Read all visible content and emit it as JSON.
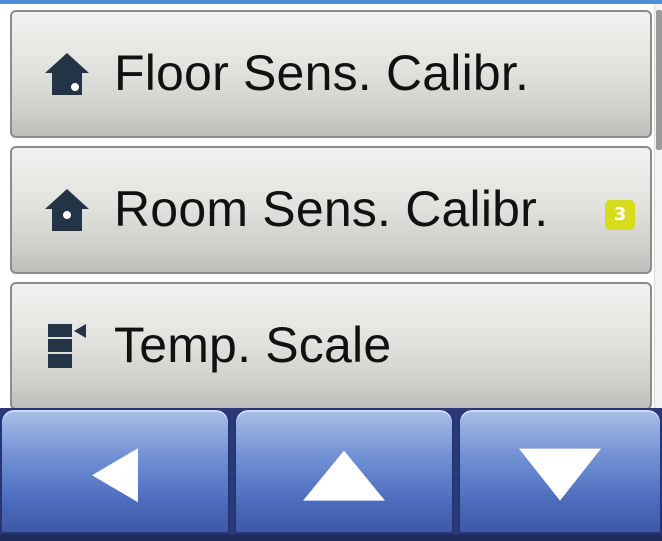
{
  "menu": {
    "items": [
      {
        "label": "Floor Sens. Calibr.",
        "icon": "house-icon"
      },
      {
        "label": "Room Sens. Calibr.",
        "icon": "house-icon",
        "badge": "3"
      },
      {
        "label": "Temp. Scale",
        "icon": "temp-scale-icon"
      }
    ]
  },
  "nav": {
    "buttons": [
      {
        "icon": "arrow-left-icon"
      },
      {
        "icon": "arrow-up-icon"
      },
      {
        "icon": "arrow-down-icon"
      }
    ]
  },
  "colors": {
    "accent_blue": "#4b8fd8",
    "nav_blue": "#4d6bbc",
    "badge_yellow": "#d6dc1c",
    "icon_dark": "#243447"
  }
}
